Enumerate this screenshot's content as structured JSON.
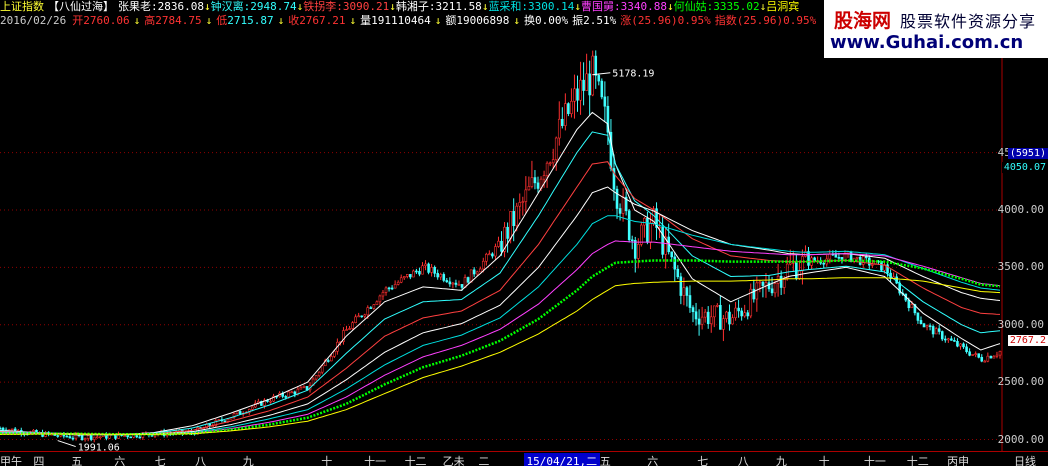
{
  "header": {
    "index_name": "上证指数",
    "indicator_name": "【八仙过海】",
    "immortals": [
      {
        "name": "张果老",
        "value": "2836.08",
        "color": "#ffffff"
      },
      {
        "name": "钟汉离",
        "value": "2948.74",
        "color": "#30ffff"
      },
      {
        "name": "铁拐李",
        "value": "3090.21",
        "color": "#ff4040"
      },
      {
        "name": "韩湘子",
        "value": "3211.58",
        "color": "#ffffff"
      },
      {
        "name": "蓝采和",
        "value": "3300.14",
        "color": "#00e0e0"
      },
      {
        "name": "曹国舅",
        "value": "3340.88",
        "color": "#ff40ff"
      },
      {
        "name": "何仙姑",
        "value": "3335.02",
        "color": "#00ff00"
      },
      {
        "name": "吕洞宾",
        "value": "",
        "color": "#ffff00"
      }
    ],
    "date": "2016/02/26",
    "open_label": "开",
    "open": "2760.06",
    "high_label": "高",
    "high": "2784.75",
    "low_label": "低",
    "low": "2715.87",
    "close_label": "收",
    "close": "2767.21",
    "volume_label": "量",
    "volume": "191110464",
    "amount_label": "额",
    "amount": "19006898",
    "turnover_label": "换",
    "turnover": "0.00%",
    "amplitude_label": "振",
    "amplitude": "2.51%",
    "change_label": "涨",
    "change": "(25.96)0.95%",
    "index_chg_label": "指数",
    "index_chg": "(25.96)0.95%"
  },
  "logo": {
    "title": "股海网",
    "subtitle": "股票软件资源分享",
    "url": "www.Guhai.com.cn"
  },
  "annotations": {
    "high_point": "5178.19",
    "low_point": "1991.06",
    "right_tag_top": "(5951)",
    "right_tag_mid": "4050.07",
    "last_price_tag": "2767.2"
  },
  "xaxis_ticks": [
    "甲午",
    "四",
    "五",
    "六",
    "七",
    "八",
    "九",
    "十",
    "十一",
    "十二",
    "乙未",
    "二",
    "15/04/21,二",
    "五",
    "六",
    "七",
    "八",
    "九",
    "十",
    "十一",
    "十二",
    "丙申",
    "日线"
  ],
  "colors": {
    "up": "#ff3030",
    "down": "#40ffff",
    "grid": "#900000"
  },
  "chart_data": {
    "type": "line",
    "title": "上证指数 八仙过海",
    "xlabel": "",
    "ylabel": "",
    "ylim": [
      2000,
      5000
    ],
    "y_ticks": [
      2000,
      2500,
      3000,
      3500,
      4000,
      4500
    ],
    "x_period": "2014-01 to 2016-02 (daily)",
    "price": {
      "name": "上证指数",
      "x_month": [
        0,
        1,
        2,
        3,
        4,
        5,
        6,
        7,
        8,
        9,
        10,
        11,
        12,
        13,
        14,
        15,
        15.4,
        15.8,
        16,
        16.5,
        17,
        18,
        19,
        20,
        20.5,
        21,
        22,
        23,
        24,
        25,
        25.5,
        26
      ],
      "values": [
        2100,
        2050,
        2020,
        2030,
        2050,
        2060,
        2200,
        2350,
        2450,
        2950,
        3300,
        3500,
        3350,
        3700,
        4300,
        5000,
        5178,
        4700,
        4200,
        3700,
        3900,
        3100,
        3050,
        3350,
        3500,
        3550,
        3600,
        3500,
        3000,
        2800,
        2700,
        2767
      ]
    },
    "series": [
      {
        "name": "张果老",
        "color": "#ffffff",
        "values": [
          2080,
          2060,
          2040,
          2040,
          2060,
          2120,
          2230,
          2350,
          2500,
          2900,
          3200,
          3330,
          3300,
          3600,
          4150,
          4700,
          4850,
          4750,
          4400,
          4000,
          3900,
          3400,
          3200,
          3350,
          3420,
          3450,
          3500,
          3420,
          3100,
          2880,
          2780,
          2836
        ]
      },
      {
        "name": "钟汉离",
        "color": "#30ffff",
        "values": [
          2075,
          2060,
          2045,
          2040,
          2055,
          2100,
          2190,
          2300,
          2430,
          2750,
          3050,
          3200,
          3220,
          3450,
          3950,
          4500,
          4680,
          4650,
          4400,
          4080,
          3950,
          3600,
          3420,
          3430,
          3460,
          3480,
          3510,
          3460,
          3200,
          3000,
          2930,
          2948
        ]
      },
      {
        "name": "铁拐李",
        "color": "#ff4040",
        "values": [
          2070,
          2060,
          2045,
          2040,
          2050,
          2080,
          2160,
          2250,
          2370,
          2620,
          2900,
          3060,
          3120,
          3300,
          3700,
          4200,
          4400,
          4420,
          4300,
          4100,
          4000,
          3750,
          3600,
          3560,
          3550,
          3550,
          3560,
          3520,
          3320,
          3150,
          3100,
          3090
        ]
      },
      {
        "name": "韩湘子",
        "color": "#ffffff",
        "values": [
          2065,
          2060,
          2048,
          2040,
          2048,
          2068,
          2130,
          2210,
          2310,
          2520,
          2760,
          2930,
          3010,
          3170,
          3500,
          3950,
          4150,
          4200,
          4150,
          4050,
          3990,
          3820,
          3700,
          3650,
          3620,
          3610,
          3620,
          3580,
          3420,
          3280,
          3230,
          3211
        ]
      },
      {
        "name": "蓝采和",
        "color": "#00e0e0",
        "values": [
          2060,
          2058,
          2050,
          2042,
          2046,
          2060,
          2110,
          2180,
          2260,
          2440,
          2650,
          2820,
          2910,
          3060,
          3330,
          3700,
          3880,
          3950,
          3950,
          3900,
          3880,
          3780,
          3700,
          3660,
          3640,
          3630,
          3640,
          3610,
          3490,
          3370,
          3320,
          3300
        ]
      },
      {
        "name": "曹国舅",
        "color": "#ff40ff",
        "values": [
          2055,
          2055,
          2050,
          2044,
          2045,
          2055,
          2095,
          2150,
          2220,
          2370,
          2560,
          2720,
          2820,
          2960,
          3180,
          3480,
          3620,
          3700,
          3730,
          3720,
          3720,
          3680,
          3640,
          3620,
          3610,
          3610,
          3620,
          3600,
          3510,
          3410,
          3360,
          3340
        ]
      },
      {
        "name": "何仙姑",
        "color": "#00ff00",
        "values": [
          2050,
          2052,
          2050,
          2046,
          2046,
          2052,
          2085,
          2130,
          2190,
          2310,
          2480,
          2630,
          2730,
          2860,
          3050,
          3300,
          3420,
          3500,
          3540,
          3550,
          3560,
          3560,
          3550,
          3550,
          3550,
          3550,
          3560,
          3550,
          3490,
          3400,
          3350,
          3335
        ]
      },
      {
        "name": "吕洞宾",
        "color": "#ffff00",
        "values": [
          2045,
          2048,
          2048,
          2046,
          2046,
          2050,
          2075,
          2110,
          2160,
          2260,
          2400,
          2540,
          2640,
          2760,
          2920,
          3120,
          3220,
          3300,
          3340,
          3360,
          3370,
          3380,
          3380,
          3390,
          3400,
          3400,
          3410,
          3410,
          3380,
          3320,
          3290,
          3280
        ]
      }
    ]
  }
}
